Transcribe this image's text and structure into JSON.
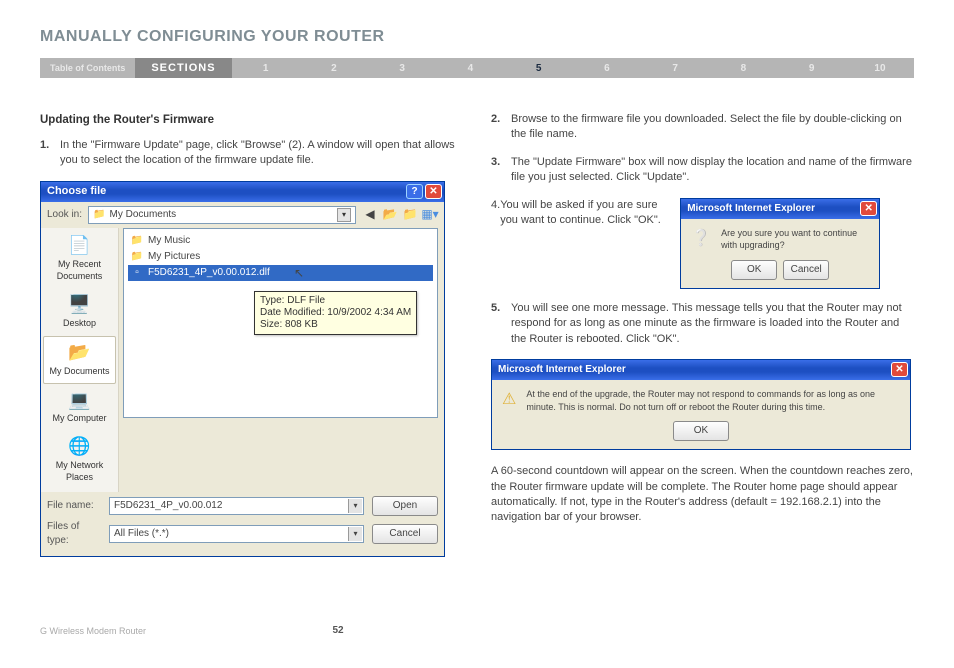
{
  "page_title": "MANUALLY CONFIGURING YOUR ROUTER",
  "nav": {
    "toc": "Table of Contents",
    "sections_label": "SECTIONS",
    "items": [
      "1",
      "2",
      "3",
      "4",
      "5",
      "6",
      "7",
      "8",
      "9",
      "10"
    ],
    "active": "5"
  },
  "subhead": "Updating the Router's Firmware",
  "steps": {
    "s1_num": "1.",
    "s1_text": "In the \"Firmware Update\" page, click \"Browse\" (2). A window will open that allows you to select the location of the firmware update file.",
    "s2_num": "2.",
    "s2_text": "Browse to the firmware file you downloaded. Select the file by double-clicking on the file name.",
    "s3_num": "3.",
    "s3_text": "The \"Update Firmware\" box will now display the location and name of the firmware file you just selected. Click \"Update\".",
    "s4_num": "4.",
    "s4_text": "You will be asked if you are sure you want to continue. Click \"OK\".",
    "s5_num": "5.",
    "s5_text": "You will see one more message. This message tells you that the Router may not respond for as long as one minute as the firmware is loaded into the Router and the Router is rebooted. Click \"OK\"."
  },
  "closing": "A 60-second countdown will appear on the screen. When the countdown reaches zero, the Router firmware update will be complete. The Router home page should appear automatically. If not, type in the Router's address (default = 192.168.2.1) into the navigation bar of your browser.",
  "dialog": {
    "title": "Choose file",
    "lookin_label": "Look in:",
    "lookin_value": "My Documents",
    "sidebar": {
      "recent": "My Recent Documents",
      "desktop": "Desktop",
      "mydocs": "My Documents",
      "mycomp": "My Computer",
      "mynet": "My Network Places"
    },
    "files": {
      "f1": "My Music",
      "f2": "My Pictures",
      "f3": "F5D6231_4P_v0.00.012.dlf"
    },
    "tooltip_l1": "Type: DLF File",
    "tooltip_l2": "Date Modified: 10/9/2002 4:34 AM",
    "tooltip_l3": "Size: 808 KB",
    "filename_label": "File name:",
    "filename_value": "F5D6231_4P_v0.00.012",
    "filetype_label": "Files of type:",
    "filetype_value": "All Files (*.*)",
    "open": "Open",
    "cancel": "Cancel"
  },
  "msg1": {
    "title": "Microsoft Internet Explorer",
    "text": "Are you sure you want to continue with upgrading?",
    "ok": "OK",
    "cancel": "Cancel"
  },
  "msg2": {
    "title": "Microsoft Internet Explorer",
    "text": "At the end of the upgrade, the Router may not respond to commands for as long as one minute. This is normal. Do not turn off or reboot the Router during this time.",
    "ok": "OK"
  },
  "footer": {
    "product": "G Wireless Modem Router",
    "page": "52"
  }
}
